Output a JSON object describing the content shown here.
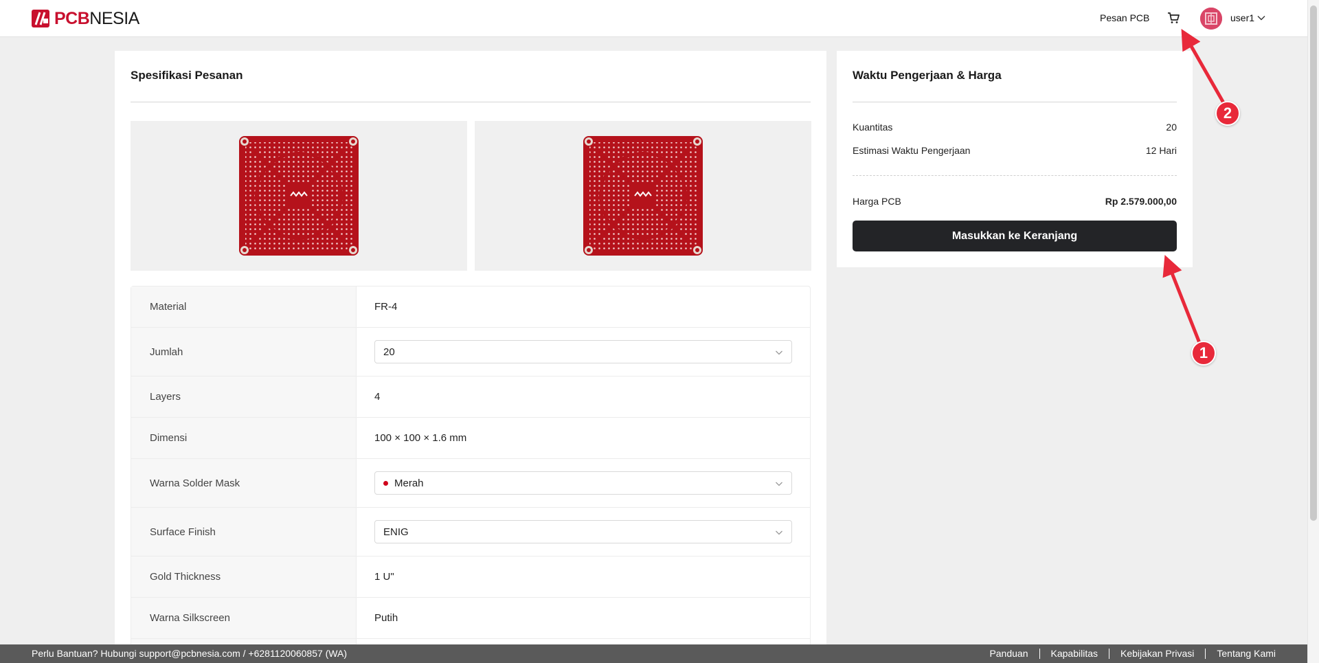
{
  "header": {
    "brand_pcb": "PCB",
    "brand_nesia": "NESIA",
    "nav_link": "Pesan PCB",
    "username": "user1"
  },
  "spec": {
    "title": "Spesifikasi Pesanan",
    "rows": [
      {
        "label": "Material",
        "value": "FR-4"
      },
      {
        "label": "Jumlah",
        "value": "20"
      },
      {
        "label": "Layers",
        "value": "4"
      },
      {
        "label": "Dimensi",
        "value": "100 × 100 × 1.6 mm"
      },
      {
        "label": "Warna Solder Mask",
        "value": "Merah"
      },
      {
        "label": "Surface Finish",
        "value": "ENIG"
      },
      {
        "label": "Gold Thickness",
        "value": "1 U\""
      },
      {
        "label": "Warna Silkscreen",
        "value": "Putih"
      }
    ]
  },
  "price": {
    "title": "Waktu Pengerjaan & Harga",
    "qty_label": "Kuantitas",
    "qty_value": "20",
    "eta_label": "Estimasi Waktu Pengerjaan",
    "eta_value": "12 Hari",
    "price_label": "Harga PCB",
    "price_value": "Rp 2.579.000,00",
    "button_label": "Masukkan ke Keranjang"
  },
  "annotations": {
    "badge1": "1",
    "badge2": "2",
    "color": "#e8293a"
  },
  "footer": {
    "help_text": "Perlu Bantuan? Hubungi  support@pcbnesia.com  /  +6281120060857 (WA)",
    "links": [
      "Panduan",
      "Kapabilitas",
      "Kebijakan Privasi",
      "Tentang Kami"
    ]
  },
  "colors": {
    "brand_red": "#c8102e",
    "pcb_red": "#b5121b",
    "button_dark": "#232427"
  },
  "icons": [
    "logo-mark",
    "cart-icon",
    "avatar",
    "chevron-down-icon"
  ]
}
